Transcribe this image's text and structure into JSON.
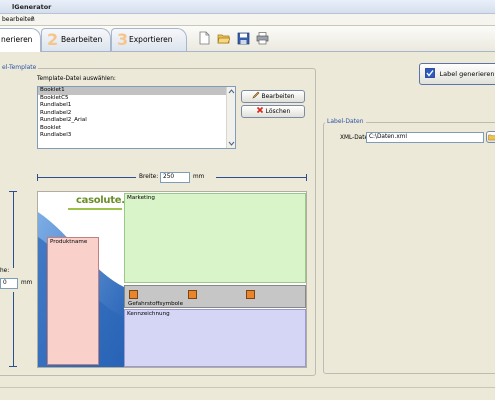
{
  "window": {
    "title": "lGenerator"
  },
  "menu": {
    "items": [
      "bearbeiten",
      "?"
    ]
  },
  "tabs": [
    {
      "num": "",
      "label": "nerieren"
    },
    {
      "num": "2",
      "label": "Bearbeiten"
    },
    {
      "num": "3",
      "label": "Exportieren"
    }
  ],
  "toolbar": {
    "icons": [
      "new-document-icon",
      "open-folder-icon",
      "save-disk-icon",
      "print-icon"
    ]
  },
  "label_template": {
    "title": "el-Template",
    "template_file_label": "Template-Datei auswählen:",
    "templates": [
      "Booklet1",
      "BookletC5",
      "Rundlabel1",
      "Rundlabel2",
      "Rundlabel2_Arial",
      "Booklet",
      "Rundlabel3"
    ],
    "selected_index": 0,
    "edit_button": "Bearbeiten",
    "delete_button": "Löschen",
    "width_label": "Breite:",
    "width_value": "250",
    "width_unit": "mm",
    "height_label": "he:",
    "height_value": "0",
    "height_unit": "mm"
  },
  "preview": {
    "logo": "casolute.",
    "marketing": "Marketing",
    "produktname": "Produktname",
    "gefahrstoff": "Gefahrstoffsymbole",
    "kennzeichnung": "Kennzeichnung",
    "colors": {
      "marketing_bg": "#d8f4c8",
      "produkt_bg": "#fad0cb",
      "kennzeichnung_bg": "#d5d6f5",
      "gefahr_bg": "#c0c0c0",
      "blue_band": "#2c66b8"
    }
  },
  "actions": {
    "generate_button": "Label generieren"
  },
  "label_data": {
    "title": "Label-Daten",
    "xml_label": "XML-Datei:",
    "xml_value": "C:\\Daten.xml"
  }
}
